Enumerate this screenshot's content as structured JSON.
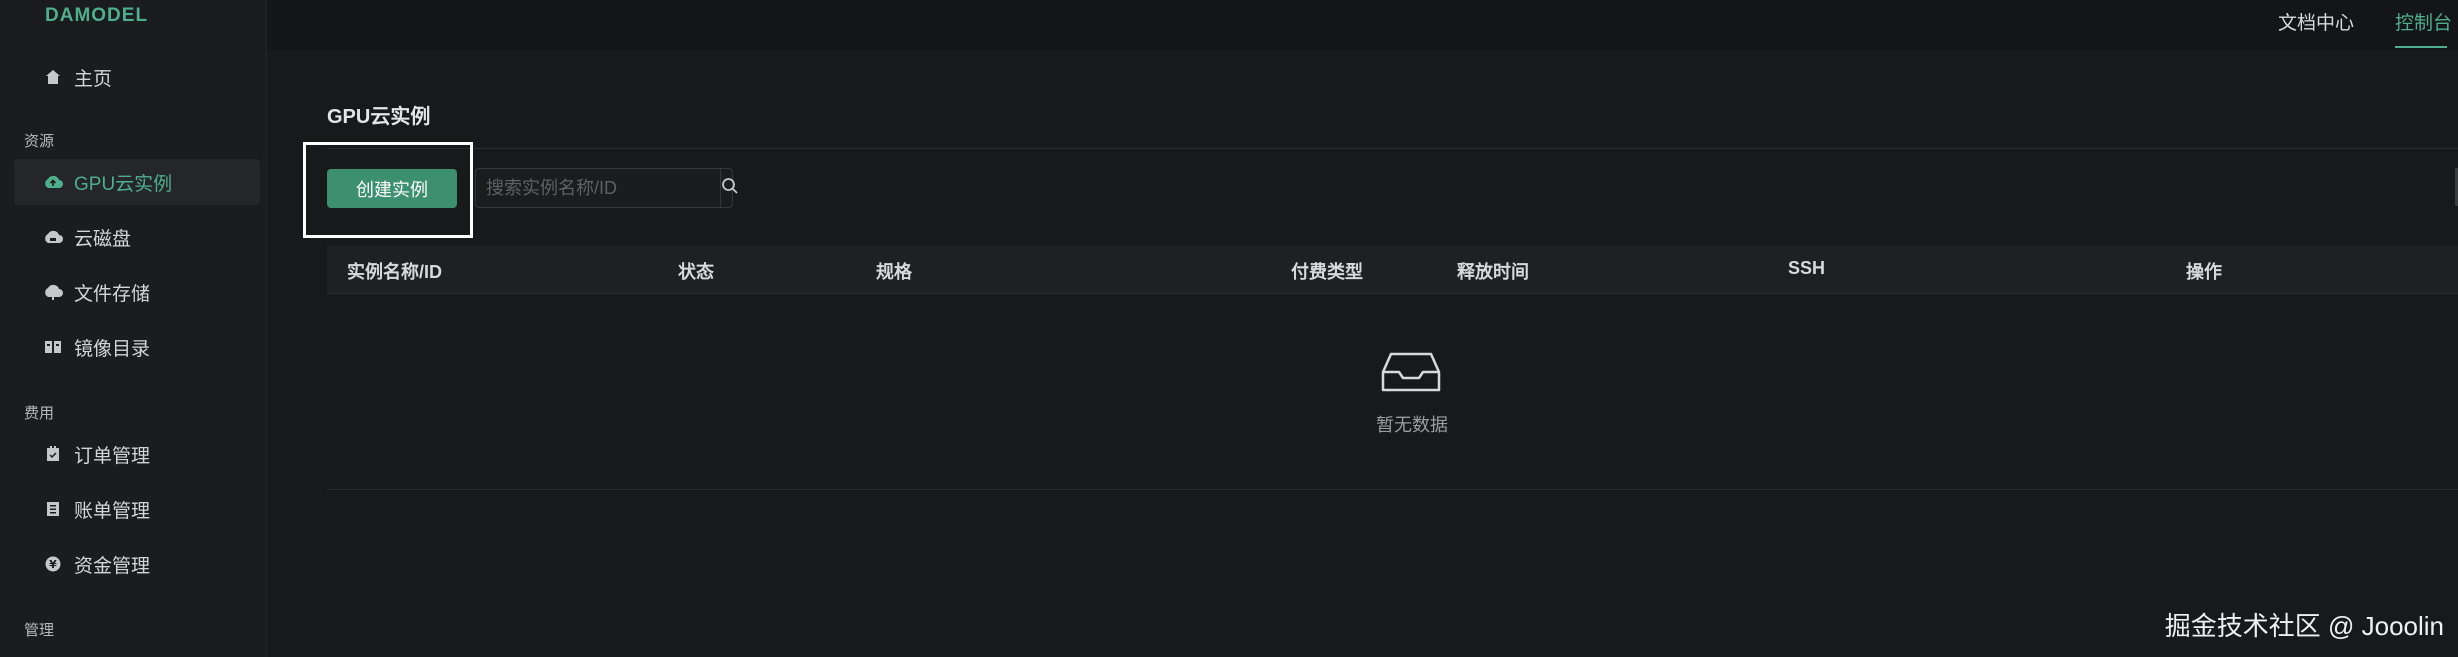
{
  "app": {
    "logo": "DAMODEL"
  },
  "topnav": {
    "docs": "文档中心",
    "console": "控制台"
  },
  "sidebar": {
    "home": "主页",
    "group_resources": "资源",
    "resources": [
      {
        "label": "GPU云实例",
        "icon": "cloud-upload-icon"
      },
      {
        "label": "云磁盘",
        "icon": "cloud-disk-icon"
      },
      {
        "label": "文件存储",
        "icon": "cloud-file-icon"
      },
      {
        "label": "镜像目录",
        "icon": "image-book-icon"
      }
    ],
    "group_billing": "费用",
    "billing": [
      {
        "label": "订单管理",
        "icon": "order-icon"
      },
      {
        "label": "账单管理",
        "icon": "bill-icon"
      },
      {
        "label": "资金管理",
        "icon": "funds-icon"
      }
    ],
    "group_manage": "管理"
  },
  "main": {
    "title": "GPU云实例",
    "create_button": "创建实例",
    "search_placeholder": "搜索实例名称/ID",
    "columns": [
      "实例名称/ID",
      "状态",
      "规格",
      "付费类型",
      "释放时间",
      "SSH",
      "操作"
    ],
    "empty_text": "暂无数据"
  },
  "watermark": "掘金技术社区 @ Jooolin",
  "colors": {
    "accent": "#4fae8b",
    "button": "#3c8f6f",
    "background": "#18191b"
  }
}
